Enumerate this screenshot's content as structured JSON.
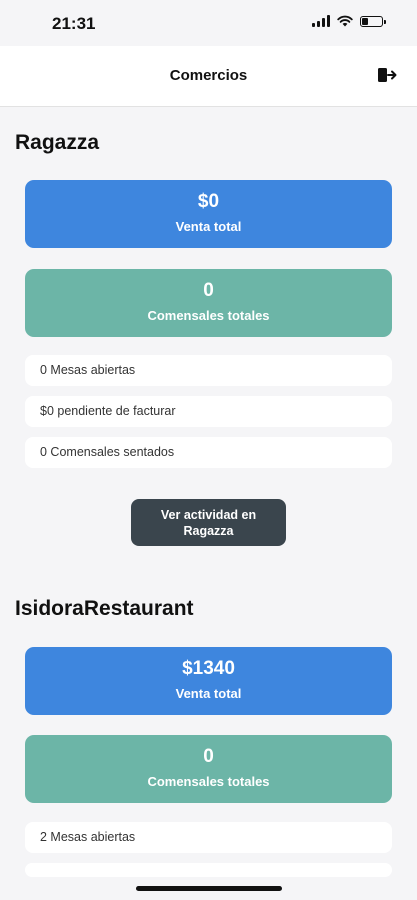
{
  "status_bar": {
    "time": "21:31",
    "battery_level": 0.3
  },
  "nav": {
    "title": "Comercios",
    "logout_icon": "logout-icon"
  },
  "stores": [
    {
      "name": "Ragazza",
      "sales_value": "$0",
      "sales_label": "Venta total",
      "diners_value": "0",
      "diners_label": "Comensales totales",
      "stats": [
        "0 Mesas abiertas",
        "$0 pendiente de facturar",
        "0 Comensales sentados"
      ],
      "button_label": "Ver actividad en Ragazza"
    },
    {
      "name": "IsidoraRestaurant",
      "sales_value": "$1340",
      "sales_label": "Venta total",
      "diners_value": "0",
      "diners_label": "Comensales totales",
      "stats": [
        "2 Mesas abiertas"
      ]
    }
  ],
  "colors": {
    "sales_card": "#3e86de",
    "diners_card": "#6cb5a7",
    "action_button": "#3a454d"
  }
}
